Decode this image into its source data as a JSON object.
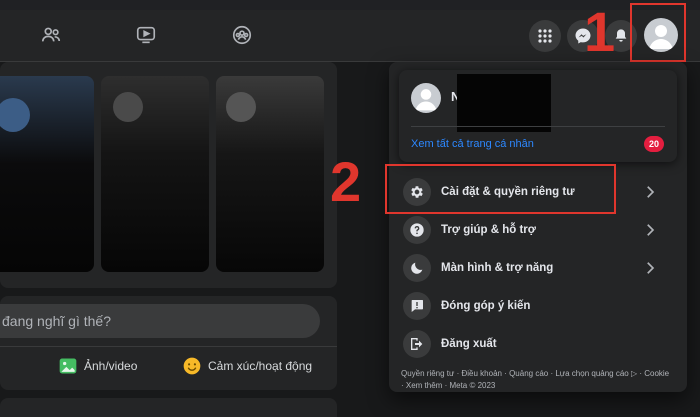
{
  "nav": {
    "icons": [
      "friends-icon",
      "watch-icon",
      "groups-icon",
      "menu-grid-icon",
      "messenger-icon",
      "notifications-icon",
      "account-icon"
    ]
  },
  "annotations": {
    "step1": "1",
    "step2": "2"
  },
  "feed": {
    "compose_placeholder": "đang nghĩ gì thế?",
    "photo_video_label": "Ảnh/video",
    "feeling_label": "Cảm xúc/hoạt động"
  },
  "menu": {
    "profile_name": "N",
    "see_all_profiles": "Xem tất cả trang cá nhân",
    "profiles_badge": "20",
    "items": [
      {
        "label": "Cài đặt & quyền riêng tư",
        "icon": "gear-icon",
        "has_chevron": true
      },
      {
        "label": "Trợ giúp & hỗ trợ",
        "icon": "question-icon",
        "has_chevron": true
      },
      {
        "label": "Màn hình & trợ năng",
        "icon": "moon-icon",
        "has_chevron": true
      },
      {
        "label": "Đóng góp ý kiến",
        "icon": "feedback-icon",
        "has_chevron": false
      },
      {
        "label": "Đăng xuất",
        "icon": "logout-icon",
        "has_chevron": false
      }
    ],
    "footer": "Quyền riêng tư · Điều khoản · Quảng cáo · Lựa chọn quảng cáo ▷ · Cookie · Xem thêm · Meta © 2023"
  },
  "colors": {
    "accent_red": "#e0362d",
    "link_blue": "#2d88ff",
    "badge_red": "#e41e3f"
  }
}
